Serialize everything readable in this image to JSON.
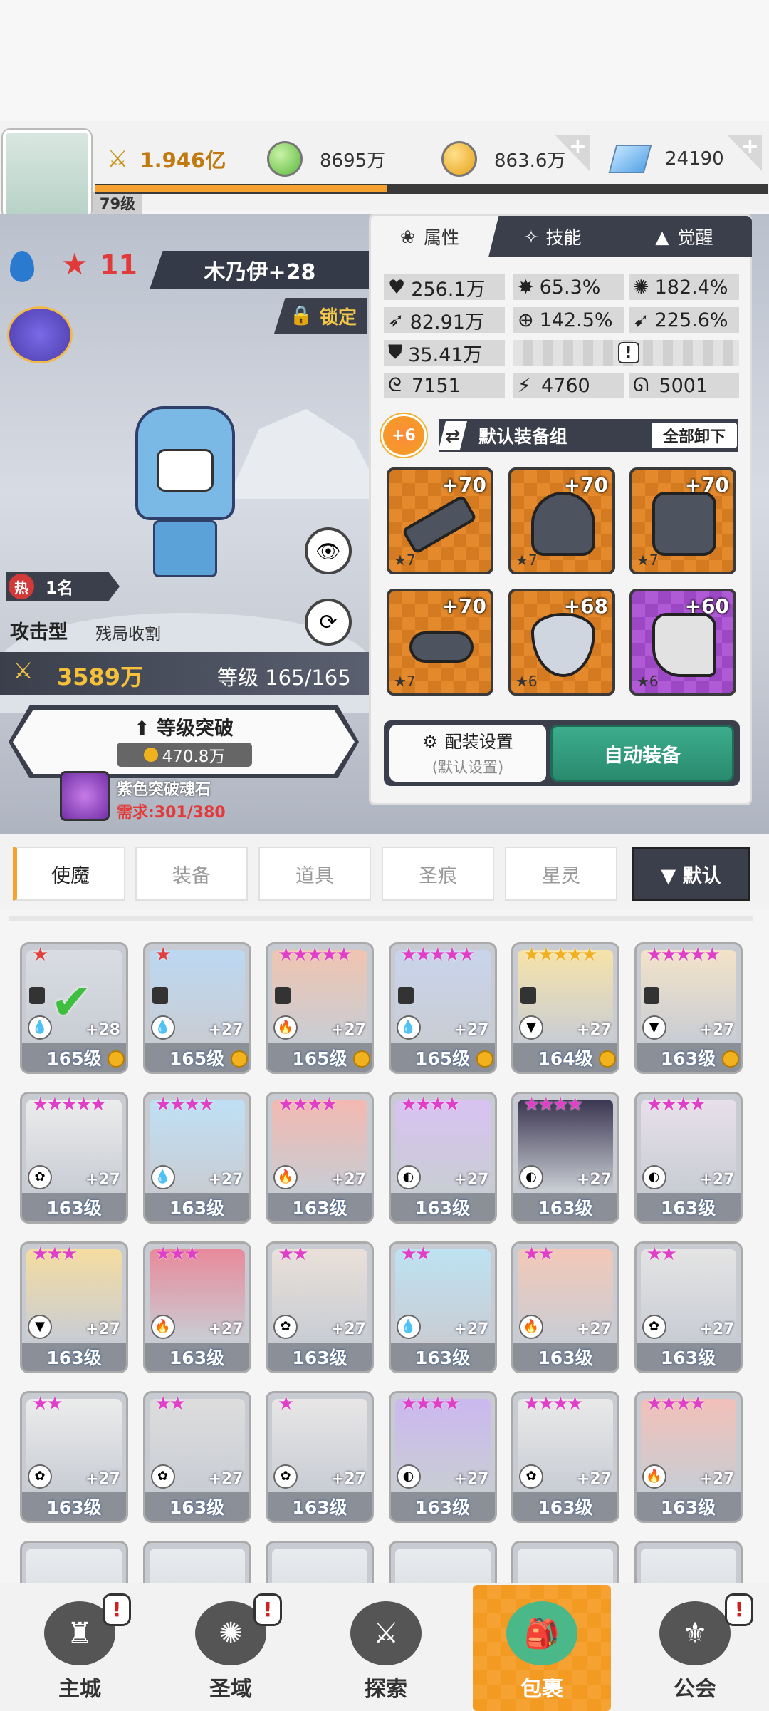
{
  "header": {
    "level_label": "79级",
    "power": "1.946亿",
    "green_currency": "8695万",
    "gold_currency": "863.6万",
    "gem_currency": "24190",
    "plus_label": "+"
  },
  "hero": {
    "star_count": "11",
    "name": "木乃伊+28",
    "lock_label": "锁定",
    "hot_label": "热",
    "rank": "1名",
    "type_label": "攻击型",
    "trait_label": "残局收割",
    "power": "3589万",
    "level_text": "等级 165/165",
    "breakthrough_label": "等级突破",
    "breakthrough_cost": "470.8万",
    "material_name": "紫色突破魂石",
    "material_need": "需求:301/380"
  },
  "panel": {
    "tabs": [
      "属性",
      "技能",
      "觉醒"
    ],
    "stats": {
      "hp": "256.1万",
      "crit": "65.3%",
      "crit_dmg": "182.4%",
      "atk": "82.91万",
      "hit": "142.5%",
      "speed": "225.6%",
      "def": "35.41万",
      "v1": "7151",
      "v2": "4760",
      "v3": "5001"
    },
    "set_bonus": "+6",
    "equip_group": "默认装备组",
    "unequip_all": "全部卸下",
    "slots": [
      {
        "lvl": "+70",
        "stars": "★7"
      },
      {
        "lvl": "+70",
        "stars": "★7"
      },
      {
        "lvl": "+70",
        "stars": "★7"
      },
      {
        "lvl": "+70",
        "stars": "★7"
      },
      {
        "lvl": "+68",
        "stars": "★6"
      },
      {
        "lvl": "+60",
        "stars": "★6"
      }
    ],
    "config_label": "配装设置",
    "config_sub": "(默认设置)",
    "auto_equip": "自动装备"
  },
  "filters": {
    "tabs": [
      "使魔",
      "装备",
      "道具",
      "圣痕",
      "星灵"
    ],
    "sort": "▼ 默认"
  },
  "cards": [
    {
      "lv": "165级",
      "plus": "+28",
      "stars": "★"
    },
    {
      "lv": "165级",
      "plus": "+27",
      "stars": "★"
    },
    {
      "lv": "165级",
      "plus": "+27",
      "stars": "★★★★★"
    },
    {
      "lv": "165级",
      "plus": "+27",
      "stars": "★★★★★"
    },
    {
      "lv": "164级",
      "plus": "+27",
      "stars": "★★★★★"
    },
    {
      "lv": "163级",
      "plus": "+27",
      "stars": "★★★★★"
    },
    {
      "lv": "163级",
      "plus": "+27",
      "stars": "★★★★★"
    },
    {
      "lv": "163级",
      "plus": "+27",
      "stars": "★★★★"
    },
    {
      "lv": "163级",
      "plus": "+27",
      "stars": "★★★★"
    },
    {
      "lv": "163级",
      "plus": "+27",
      "stars": "★★★★"
    },
    {
      "lv": "163级",
      "plus": "+27",
      "stars": "★★★★"
    },
    {
      "lv": "163级",
      "plus": "+27",
      "stars": "★★★★"
    },
    {
      "lv": "163级",
      "plus": "+27",
      "stars": "★★★"
    },
    {
      "lv": "163级",
      "plus": "+27",
      "stars": "★★★"
    },
    {
      "lv": "163级",
      "plus": "+27",
      "stars": "★★"
    },
    {
      "lv": "163级",
      "plus": "+27",
      "stars": "★★"
    },
    {
      "lv": "163级",
      "plus": "+27",
      "stars": "★★"
    },
    {
      "lv": "163级",
      "plus": "+27",
      "stars": "★★"
    },
    {
      "lv": "163级",
      "plus": "+27",
      "stars": "★★"
    },
    {
      "lv": "163级",
      "plus": "+27",
      "stars": "★★"
    },
    {
      "lv": "163级",
      "plus": "+27",
      "stars": "★"
    },
    {
      "lv": "163级",
      "plus": "+27",
      "stars": "★★★★"
    },
    {
      "lv": "163级",
      "plus": "+27",
      "stars": "★★★★"
    },
    {
      "lv": "163级",
      "plus": "+27",
      "stars": "★★★★"
    }
  ],
  "nav": {
    "items": [
      "主城",
      "圣域",
      "探索",
      "包裹",
      "公会"
    ],
    "badge": "!"
  },
  "colors": {
    "accent_orange": "#f5a230",
    "auto_green": "#2f9b7e",
    "panel_dark": "#343a47"
  }
}
